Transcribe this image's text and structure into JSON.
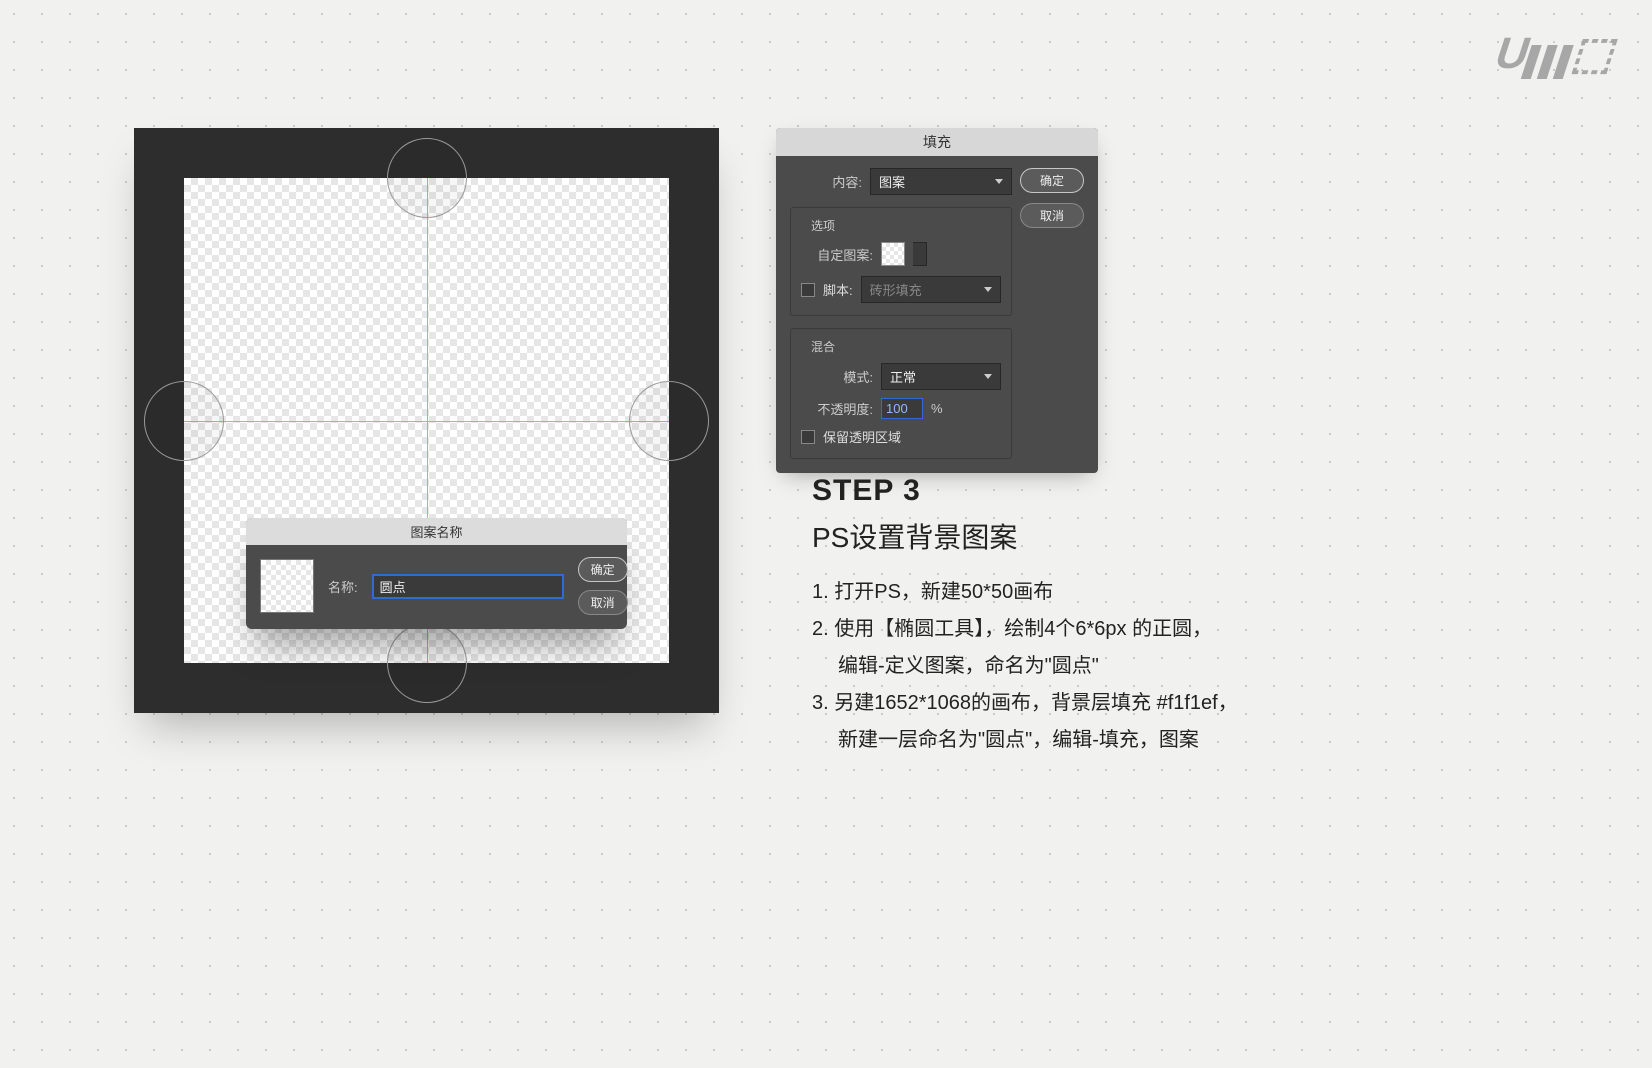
{
  "logo_text": "Uiii",
  "pattern_dialog": {
    "title": "图案名称",
    "name_label": "名称:",
    "name_value": "圆点",
    "ok": "确定",
    "cancel": "取消"
  },
  "fill_dialog": {
    "title": "填充",
    "content_label": "内容:",
    "content_value": "图案",
    "ok": "确定",
    "cancel": "取消",
    "options_legend": "选项",
    "custom_pattern_label": "自定图案:",
    "script_label": "脚本:",
    "script_value": "砖形填充",
    "blend_legend": "混合",
    "mode_label": "模式:",
    "mode_value": "正常",
    "opacity_label": "不透明度:",
    "opacity_value": "100",
    "opacity_unit": "%",
    "preserve_label": "保留透明区域"
  },
  "instructions": {
    "step": "STEP 3",
    "subtitle": "PS设置背景图案",
    "items": [
      {
        "n": "1.",
        "line1": "打开PS，新建50*50画布"
      },
      {
        "n": "2.",
        "line1": "使用【椭圆工具】，绘制4个6*6px 的正圆，",
        "line2": "编辑-定义图案，命名为\"圆点\""
      },
      {
        "n": "3.",
        "line1": "另建1652*1068的画布，背景层填充 #f1f1ef，",
        "line2": "新建一层命名为\"圆点\"，编辑-填充，图案"
      }
    ]
  },
  "colors": {
    "page_bg": "#f1f1ef",
    "panel_dark": "#4b4b4b",
    "frame_dark": "#2d2d2d",
    "guide": "#2ee8d5",
    "input_focus": "#2f6bd6"
  }
}
